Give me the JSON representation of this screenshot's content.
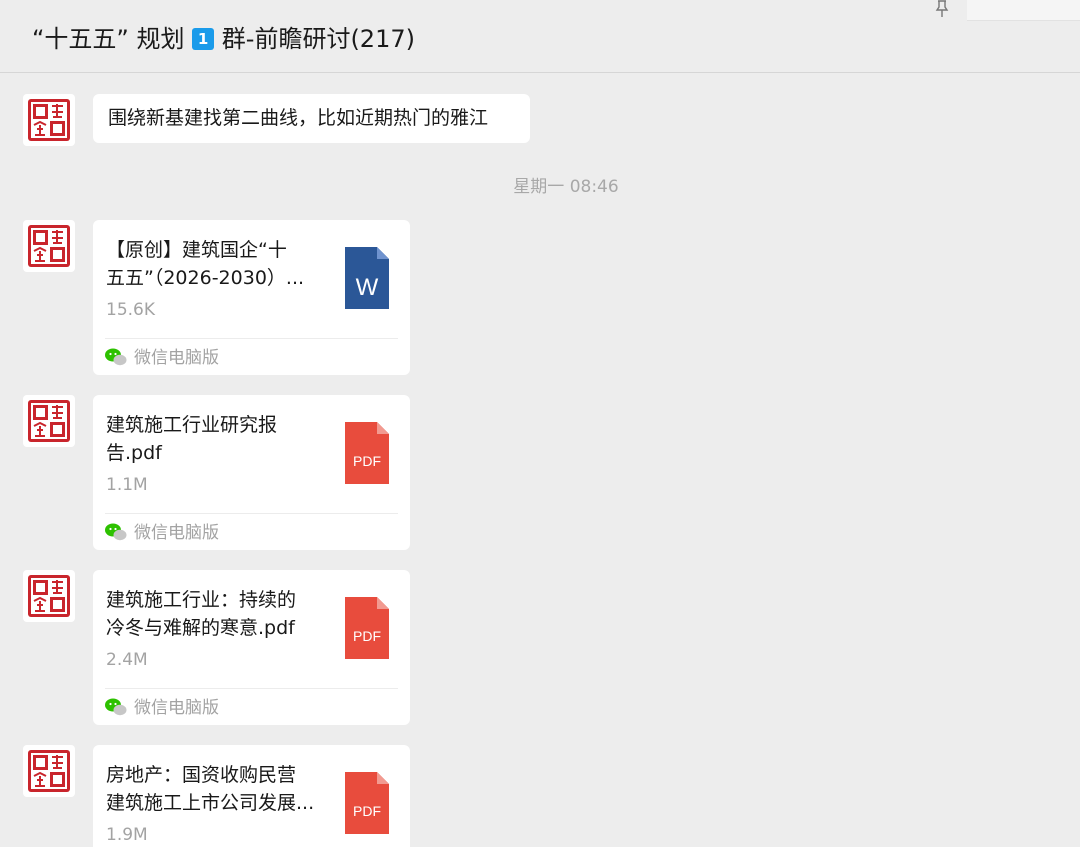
{
  "header": {
    "title_prefix": "“十五五” 规划",
    "badge": "1",
    "title_suffix": "群-前瞻研讨(217)"
  },
  "messages": {
    "text_message": "围绕新基建找第二曲线，比如近期热门的雅江",
    "timestamp": "星期一 08:46",
    "files": [
      {
        "name": "【原创】建筑国企“十\n五五”（2026-2030）...",
        "size": "15.6K",
        "type_label": "W",
        "icon": "word-file-icon",
        "source": "微信电脑版"
      },
      {
        "name": "建筑施工行业研究报\n告.pdf",
        "size": "1.1M",
        "type_label": "PDF",
        "icon": "pdf-file-icon",
        "source": "微信电脑版"
      },
      {
        "name": "建筑施工行业：持续的\n冷冬与难解的寒意.pdf",
        "size": "2.4M",
        "type_label": "PDF",
        "icon": "pdf-file-icon",
        "source": "微信电脑版"
      },
      {
        "name": "房地产：国资收购民营\n建筑施工上市公司发展...",
        "size": "1.9M",
        "type_label": "PDF",
        "icon": "pdf-file-icon",
        "source": "微信电脑版"
      }
    ]
  },
  "colors": {
    "background": "#ededed",
    "bubble": "#ffffff",
    "badge": "#1a9bea",
    "word_icon": "#2b5797",
    "pdf_icon": "#e84c3d",
    "seal_red": "#c9252c",
    "wechat_green": "#2dc100"
  },
  "icons": {
    "avatar": "red-seal-avatar-icon",
    "pin": "pin-icon",
    "source": "wechat-logo-icon"
  }
}
